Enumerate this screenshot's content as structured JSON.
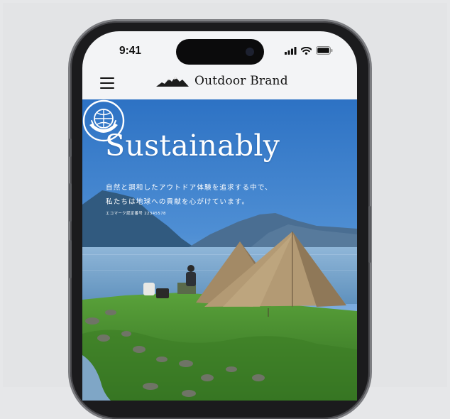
{
  "status_bar": {
    "time": "9:41"
  },
  "header": {
    "brand_name": "Outdoor Brand",
    "menu_icon": "hamburger-menu-icon",
    "logo_icon": "mountain-logo-icon"
  },
  "hero": {
    "title": "Sustainably",
    "line1": "自然と調和したアウトドア体験を追求する中で、",
    "line2": "私たちは地球への貢献を心がけています。",
    "note": "エコマーク認定番号 22345578",
    "emblem_icon": "globe-hands-emblem-icon"
  }
}
